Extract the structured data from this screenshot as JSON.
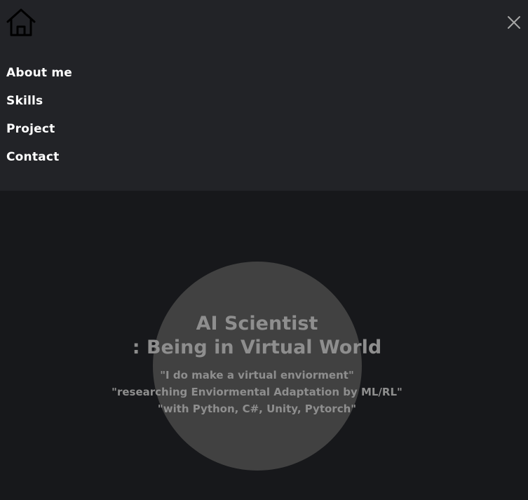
{
  "nav": {
    "home_icon": "home-icon",
    "close_icon": "close-icon",
    "items": [
      {
        "label": "About me"
      },
      {
        "label": "Skills"
      },
      {
        "label": "Project"
      },
      {
        "label": "Contact"
      }
    ]
  },
  "hero": {
    "title_line1": "AI Scientist",
    "title_line2": ": Being in Virtual World",
    "quotes": [
      "\"I do make a virtual enviorment\"",
      "\"researching Enviormental Adaptation by ML/RL\"",
      "\"with Python, C#, Unity, Pytorch\""
    ]
  },
  "colors": {
    "nav_background": "#222327",
    "page_background": "#17181b",
    "circle": "#414141",
    "hero_text": "#8e8e8e",
    "menu_text": "#ffffff"
  }
}
